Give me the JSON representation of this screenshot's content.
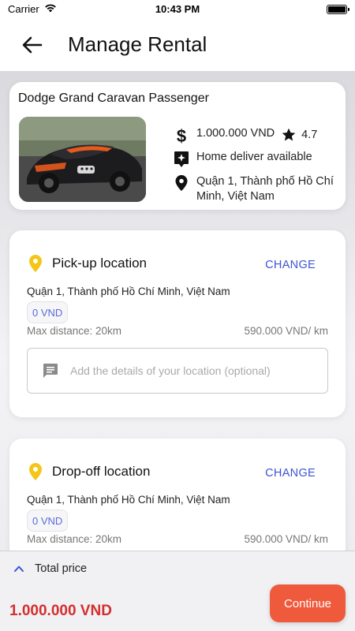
{
  "status_bar": {
    "carrier": "Carrier",
    "time": "10:43 PM"
  },
  "header": {
    "title": "Manage Rental",
    "back_icon": "arrow-left-icon"
  },
  "car": {
    "name": "Dodge Grand Caravan Passenger",
    "price": "1.000.000 VND",
    "rating": "4.7",
    "delivery": "Home deliver available",
    "location": "Quận 1, Thành phố Hồ Chí Minh, Việt Nam",
    "image_icon": "car-photo"
  },
  "pickup": {
    "title": "Pick-up location",
    "change_label": "CHANGE",
    "address": "Quận 1, Thành phố Hồ Chí Minh, Việt Nam",
    "fee": "0 VND",
    "max_distance": "Max distance: 20km",
    "per_km": "590.000 VND/ km",
    "details_placeholder": "Add the details of your location (optional)"
  },
  "dropoff": {
    "title": "Drop-off location",
    "change_label": "CHANGE",
    "address": "Quận 1, Thành phố Hồ Chí Minh, Việt Nam",
    "fee": "0 VND",
    "max_distance": "Max distance: 20km",
    "per_km": "590.000 VND/ km"
  },
  "footer": {
    "total_label": "Total price",
    "total_amount": "1.000.000 VND",
    "continue_label": "Continue"
  },
  "colors": {
    "accent_blue": "#3c54d6",
    "price_red": "#d32f2f",
    "continue_orange": "#ef5a3c",
    "pin_yellow": "#f5c518"
  }
}
